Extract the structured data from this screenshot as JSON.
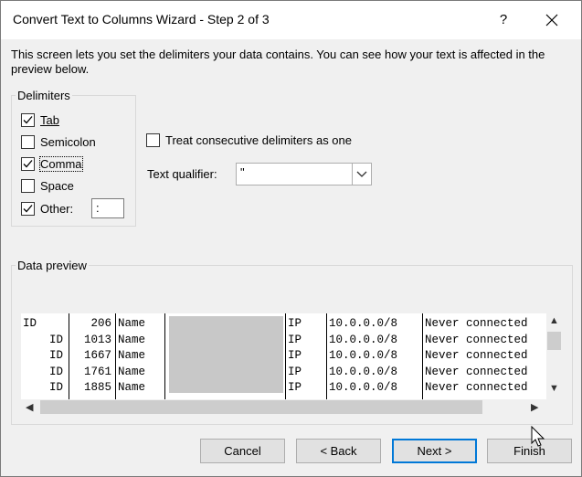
{
  "window": {
    "title": "Convert Text to Columns Wizard - Step 2 of 3",
    "help": "?",
    "close": "✕"
  },
  "description": "This screen lets you set the delimiters your data contains.  You can see how your text is affected in the preview below.",
  "delimiters": {
    "group_label": "Delimiters",
    "tab": {
      "label": "Tab",
      "checked": true
    },
    "semicolon": {
      "label": "Semicolon",
      "checked": false
    },
    "comma": {
      "label": "Comma",
      "checked": true
    },
    "space": {
      "label": "Space",
      "checked": false
    },
    "other": {
      "label": "Other:",
      "checked": true,
      "value": ":"
    }
  },
  "consecutive": {
    "label": "Treat consecutive delimiters as one",
    "checked": false
  },
  "text_qualifier": {
    "label": "Text qualifier:",
    "value": "\""
  },
  "preview": {
    "group_label": "Data preview",
    "rows": [
      [
        "ID",
        "206",
        "Name",
        "",
        "IP",
        "10.0.0.0/8",
        "Never connected"
      ],
      [
        "ID",
        "1013",
        "Name",
        "",
        "IP",
        "10.0.0.0/8",
        "Never connected"
      ],
      [
        "ID",
        "1667",
        "Name",
        "",
        "IP",
        "10.0.0.0/8",
        "Never connected"
      ],
      [
        "ID",
        "1761",
        "Name",
        "",
        "IP",
        "10.0.0.0/8",
        "Never connected"
      ],
      [
        "ID",
        "1885",
        "Name",
        "",
        "IP",
        "10.0.0.0/8",
        "Never connected"
      ]
    ]
  },
  "buttons": {
    "cancel": "Cancel",
    "back": "< Back",
    "next": "Next >",
    "finish": "Finish"
  }
}
